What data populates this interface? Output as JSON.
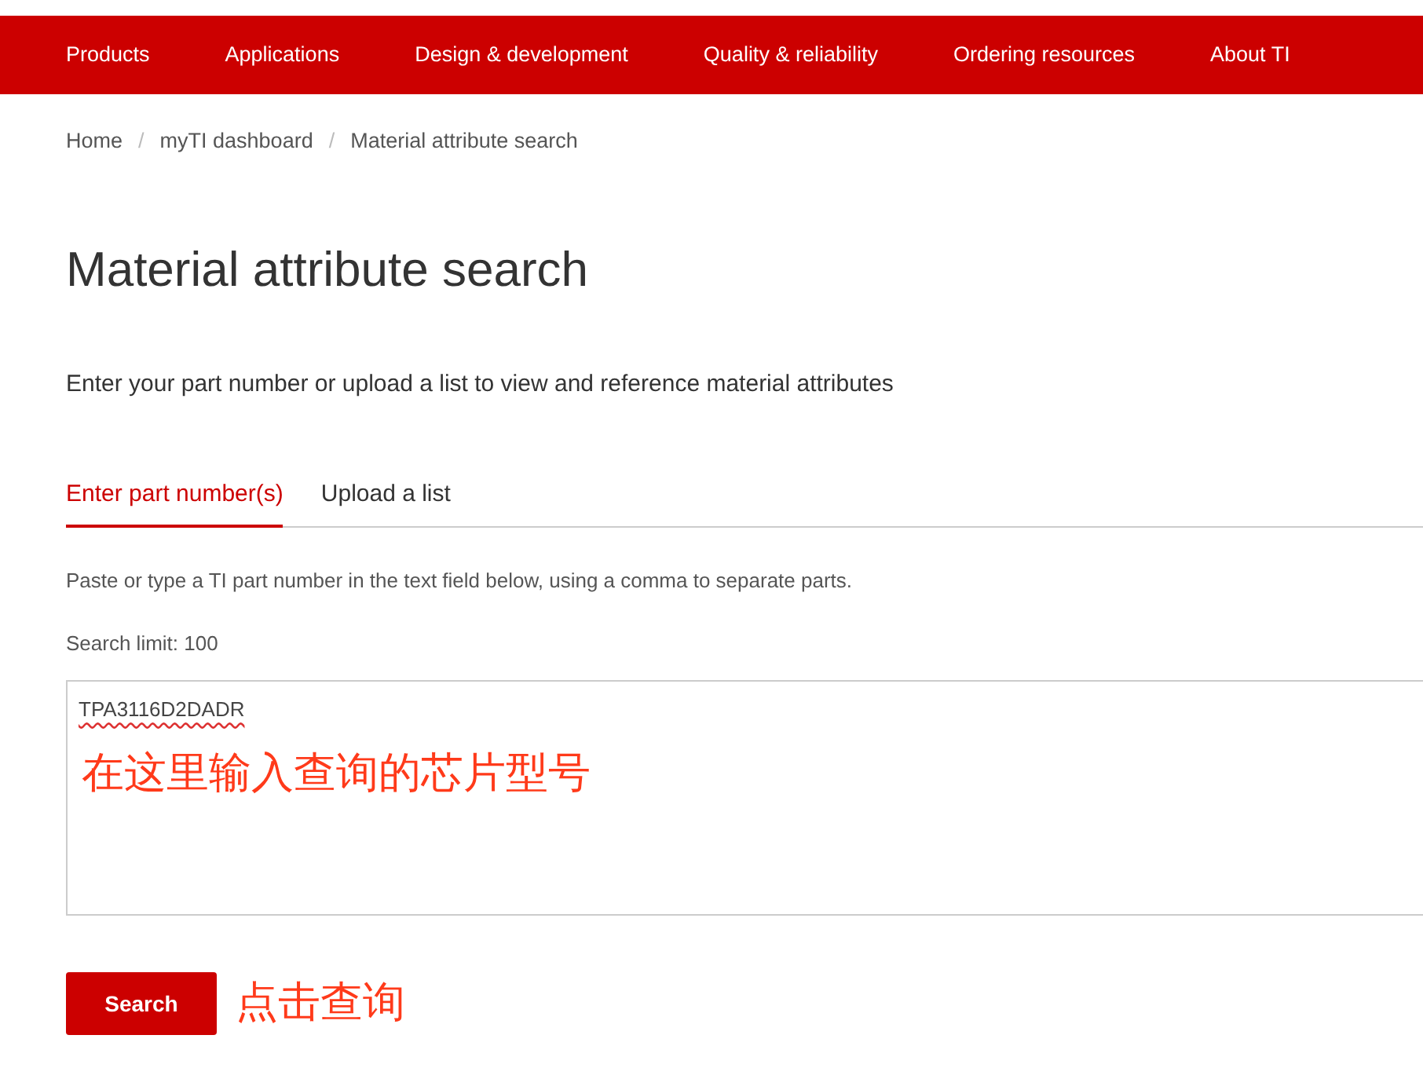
{
  "nav": {
    "items": [
      "Products",
      "Applications",
      "Design & development",
      "Quality & reliability",
      "Ordering resources",
      "About TI"
    ]
  },
  "breadcrumb": [
    {
      "kind": "link",
      "text": "Home"
    },
    {
      "kind": "separator",
      "text": "/"
    },
    {
      "kind": "link",
      "text": "myTI dashboard"
    },
    {
      "kind": "separator",
      "text": "/"
    },
    {
      "kind": "current",
      "text": "Material attribute search"
    }
  ],
  "title": "Material attribute search",
  "intro": "Enter your part number or upload a list to view and reference material attributes",
  "tabs": [
    {
      "label": "Enter part number(s)",
      "selected": true
    },
    {
      "label": "Upload a list",
      "selected": false
    }
  ],
  "help": "Paste or type a TI part number in the text field below, using a comma to separate parts.",
  "limit": "Search limit: 100",
  "part_field": {
    "value": "TPA3116D2DADR",
    "annotation": "在这里输入查询的芯片型号"
  },
  "search_button": {
    "label": "Search",
    "annotation": "点击查询"
  }
}
